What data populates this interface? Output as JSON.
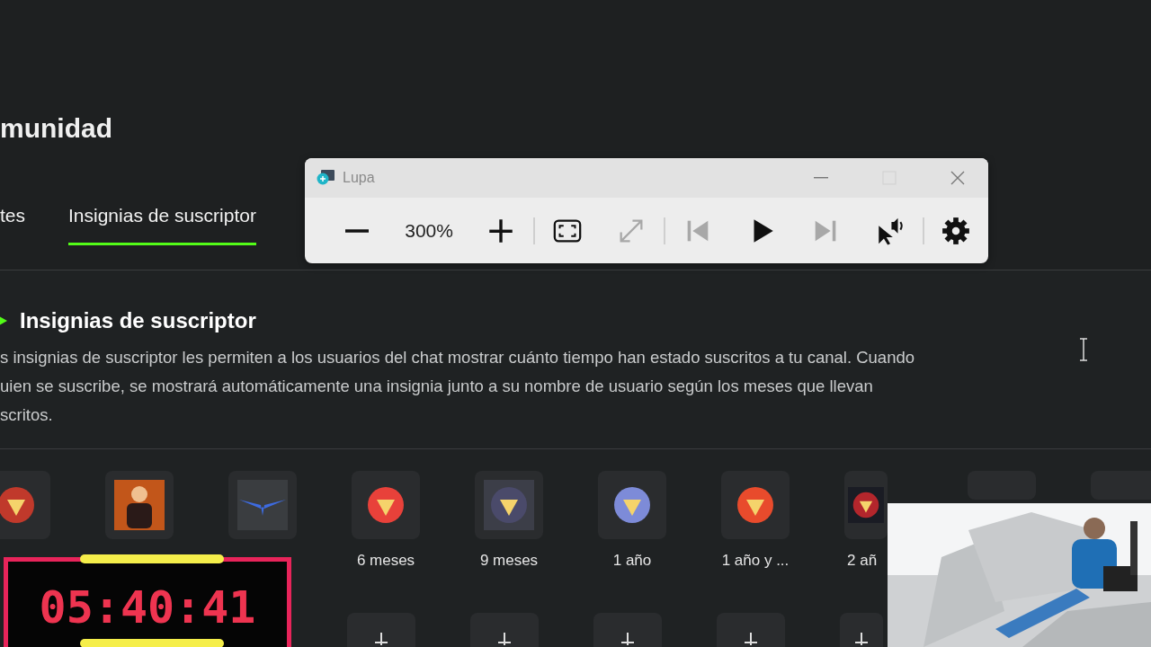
{
  "page": {
    "title": "munidad"
  },
  "tabs": [
    {
      "label": "tes",
      "selected": false
    },
    {
      "label": "Insignias de suscriptor",
      "selected": true
    }
  ],
  "section": {
    "title": "Insignias de suscriptor",
    "description": [
      "s insignias de suscriptor les permiten a los usuarios del chat mostrar cuánto tiempo han estado suscritos a tu canal. Cuando",
      "uien se suscribe, se mostrará automáticamente una insignia junto a su nombre de usuario según los meses que llevan",
      "scritos."
    ]
  },
  "badges": [
    {
      "kind": "crest"
    },
    {
      "kind": "portrait"
    },
    {
      "kind": "wings"
    },
    {
      "kind": "medal",
      "label": "6 meses"
    },
    {
      "kind": "hood",
      "label": "9 meses"
    },
    {
      "kind": "orb",
      "label": "1 año"
    },
    {
      "kind": "rosette",
      "label": "1 año y ..."
    },
    {
      "kind": "demon",
      "label": "2 añ"
    },
    {
      "kind": "blank"
    },
    {
      "kind": "blank"
    }
  ],
  "add_slots": [
    {
      "kind": "add"
    },
    {
      "kind": "add"
    },
    {
      "kind": "add"
    },
    {
      "kind": "add"
    },
    {
      "kind": "add"
    }
  ],
  "magnifier": {
    "title": "Lupa",
    "maximize_disabled": true,
    "zoom": "300%",
    "tools": [
      {
        "kind": "zoom-out",
        "disabled": false
      },
      {
        "kind": "readout"
      },
      {
        "kind": "zoom-in",
        "disabled": false
      },
      {
        "kind": "separator"
      },
      {
        "kind": "view",
        "disabled": false
      },
      {
        "kind": "expand",
        "disabled": true
      },
      {
        "kind": "separator"
      },
      {
        "kind": "previous",
        "disabled": true
      },
      {
        "kind": "play",
        "disabled": false
      },
      {
        "kind": "next",
        "disabled": true
      },
      {
        "kind": "read-cursor",
        "disabled": false
      },
      {
        "kind": "separator"
      },
      {
        "kind": "settings",
        "disabled": false
      }
    ]
  },
  "timer": {
    "time": "05:40:41"
  }
}
